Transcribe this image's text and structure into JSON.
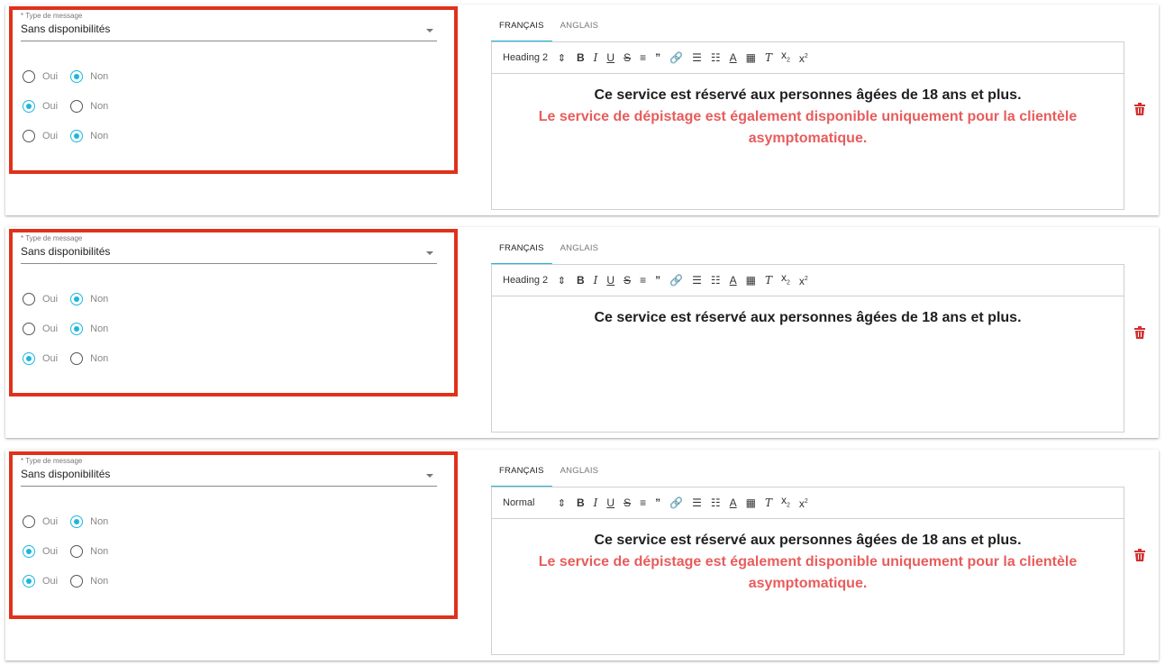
{
  "colors": {
    "accent": "#1eb6dd",
    "highlight_border": "#e0311b",
    "red_text": "#e85c5c",
    "trash": "#d32f2f"
  },
  "cards": [
    {
      "select": {
        "label": "* Type de message",
        "value": "Sans disponibilités"
      },
      "radio_rows": [
        {
          "yes": "Oui",
          "no": "Non",
          "selected": "no"
        },
        {
          "yes": "Oui",
          "no": "Non",
          "selected": "yes"
        },
        {
          "yes": "Oui",
          "no": "Non",
          "selected": "no"
        }
      ],
      "tabs": [
        "FRANÇAIS",
        "ANGLAIS"
      ],
      "active_tab": 0,
      "toolbar": {
        "format": "Heading 2"
      },
      "content": {
        "line1": "Ce service est réservé aux personnes âgées de 18 ans et plus.",
        "line2": "Le service de dépistage est également disponible uniquement pour la clientèle asymptomatique."
      },
      "delete_icon": "trash-icon"
    },
    {
      "select": {
        "label": "* Type de message",
        "value": "Sans disponibilités"
      },
      "radio_rows": [
        {
          "yes": "Oui",
          "no": "Non",
          "selected": "no"
        },
        {
          "yes": "Oui",
          "no": "Non",
          "selected": "no"
        },
        {
          "yes": "Oui",
          "no": "Non",
          "selected": "yes"
        }
      ],
      "tabs": [
        "FRANÇAIS",
        "ANGLAIS"
      ],
      "active_tab": 0,
      "toolbar": {
        "format": "Heading 2"
      },
      "content": {
        "line1": "Ce service est réservé aux personnes âgées de 18 ans et plus.",
        "line2": ""
      },
      "delete_icon": "trash-icon"
    },
    {
      "select": {
        "label": "* Type de message",
        "value": "Sans disponibilités"
      },
      "radio_rows": [
        {
          "yes": "Oui",
          "no": "Non",
          "selected": "no"
        },
        {
          "yes": "Oui",
          "no": "Non",
          "selected": "yes"
        },
        {
          "yes": "Oui",
          "no": "Non",
          "selected": "yes"
        }
      ],
      "tabs": [
        "FRANÇAIS",
        "ANGLAIS"
      ],
      "active_tab": 0,
      "toolbar": {
        "format": "Normal"
      },
      "content": {
        "line1": "Ce service est réservé aux personnes âgées de 18 ans et plus.",
        "line2": "Le service de dépistage est également disponible uniquement pour la clientèle asymptomatique."
      },
      "delete_icon": "trash-icon"
    }
  ]
}
